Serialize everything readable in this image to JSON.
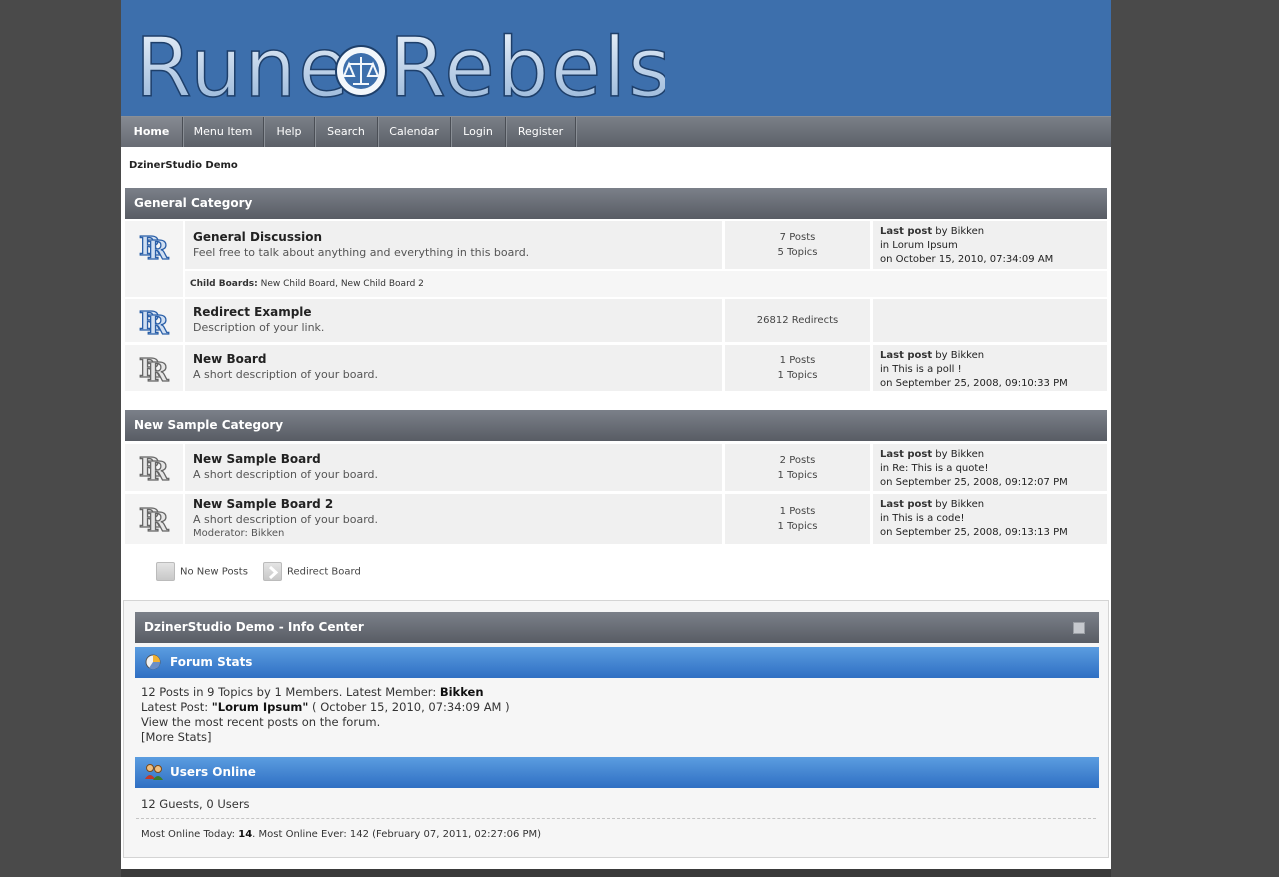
{
  "header": {
    "logo_text": "Rune Rebels"
  },
  "nav": [
    {
      "label": "Home",
      "active": true
    },
    {
      "label": "Menu Item"
    },
    {
      "label": "Help"
    },
    {
      "label": "Search"
    },
    {
      "label": "Calendar"
    },
    {
      "label": "Login"
    },
    {
      "label": "Register"
    }
  ],
  "linktree": "DzinerStudio Demo",
  "categories": [
    {
      "name": "General Category",
      "boards": [
        {
          "title": "General Discussion",
          "desc": "Feel free to talk about anything and everything in this board.",
          "posts": "7 Posts",
          "topics": "5 Topics",
          "last_label": "Last post",
          "last_by": "by Bikken",
          "last_in": "in Lorum Ipsum",
          "last_on": "on October 15, 2010, 07:34:09 AM",
          "child_label": "Child Boards:",
          "child_boards": "New Child Board, New Child Board 2"
        },
        {
          "title": "Redirect Example",
          "desc": "Description of your link.",
          "redirects": "26812 Redirects"
        },
        {
          "title": "New Board",
          "desc": "A short description of your board.",
          "posts": "1 Posts",
          "topics": "1 Topics",
          "last_label": "Last post",
          "last_by": "by Bikken",
          "last_in": "in This is a poll !",
          "last_on": "on September 25, 2008, 09:10:33 PM"
        }
      ]
    },
    {
      "name": "New Sample Category",
      "boards": [
        {
          "title": "New Sample Board",
          "desc": "A short description of your board.",
          "posts": "2 Posts",
          "topics": "1 Topics",
          "last_label": "Last post",
          "last_by": "by Bikken",
          "last_in": "in Re: This is a quote!",
          "last_on": "on September 25, 2008, 09:12:07 PM"
        },
        {
          "title": "New Sample Board 2",
          "desc": "A short description of your board.",
          "moderator": "Moderator: Bikken",
          "posts": "1 Posts",
          "topics": "1 Topics",
          "last_label": "Last post",
          "last_by": "by Bikken",
          "last_in": "in This is a code!",
          "last_on": "on September 25, 2008, 09:13:13 PM"
        }
      ]
    }
  ],
  "legend": {
    "no_new": "No New Posts",
    "redirect": "Redirect Board"
  },
  "info_center": {
    "title": "DzinerStudio Demo - Info Center",
    "forum_stats_title": "Forum Stats",
    "stats_line1_a": "12 Posts in 9 Topics by 1 Members. Latest Member: ",
    "stats_line1_member": "Bikken",
    "stats_line2_a": "Latest Post: ",
    "stats_line2_post": "\"Lorum Ipsum\"",
    "stats_line2_b": " ( October 15, 2010, 07:34:09 AM )",
    "stats_line3": "View the most recent posts on the forum.",
    "stats_line4": "[More Stats]",
    "users_online_title": "Users Online",
    "users_online": "12 Guests, 0 Users",
    "most_online_a": "Most Online Today: ",
    "most_online_today": "14",
    "most_online_b": ". Most Online Ever: 142 (February 07, 2011, 02:27:06 PM)"
  },
  "colors": {
    "header_blue": "#3d6fac",
    "bar_gray": "#6a6e76",
    "stats_blue": "#3f7fd0"
  }
}
